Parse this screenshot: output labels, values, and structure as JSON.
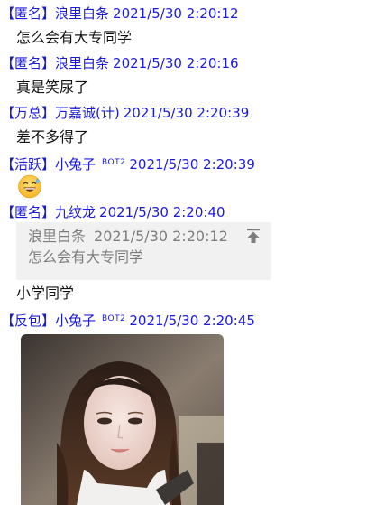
{
  "messages": [
    {
      "tag": "【匿名】",
      "name": "浪里白条",
      "time": "2021/5/30 2:20:12",
      "text": "怎么会有大专同学"
    },
    {
      "tag": "【匿名】",
      "name": "浪里白条",
      "time": "2021/5/30 2:20:16",
      "text": "真是笑尿了"
    },
    {
      "tag": "【万总】",
      "name": "万嘉诚(计)",
      "time": "2021/5/30 2:20:39",
      "text": "差不多得了"
    },
    {
      "tag": "【活跃】",
      "name": "小兔子",
      "bot": "BOT2",
      "time": "2021/5/30 2:20:39",
      "emoji": "sweat-smile-emoji"
    },
    {
      "tag": "【匿名】",
      "name": "九纹龙",
      "time": "2021/5/30 2:20:40",
      "quote": {
        "name": "浪里白条",
        "time": "2021/5/30 2:20:12",
        "text": "怎么会有大专同学",
        "icon": "jump-to-top-icon"
      },
      "text": "小学同学"
    },
    {
      "tag": "【反包】",
      "name": "小兔子",
      "bot": "BOT2",
      "time": "2021/5/30 2:20:45",
      "image": "photo-of-woman"
    }
  ],
  "colors": {
    "header": "#1a1adc",
    "quote_bg": "#f1f1f1",
    "quote_text": "#7d7d7d"
  }
}
